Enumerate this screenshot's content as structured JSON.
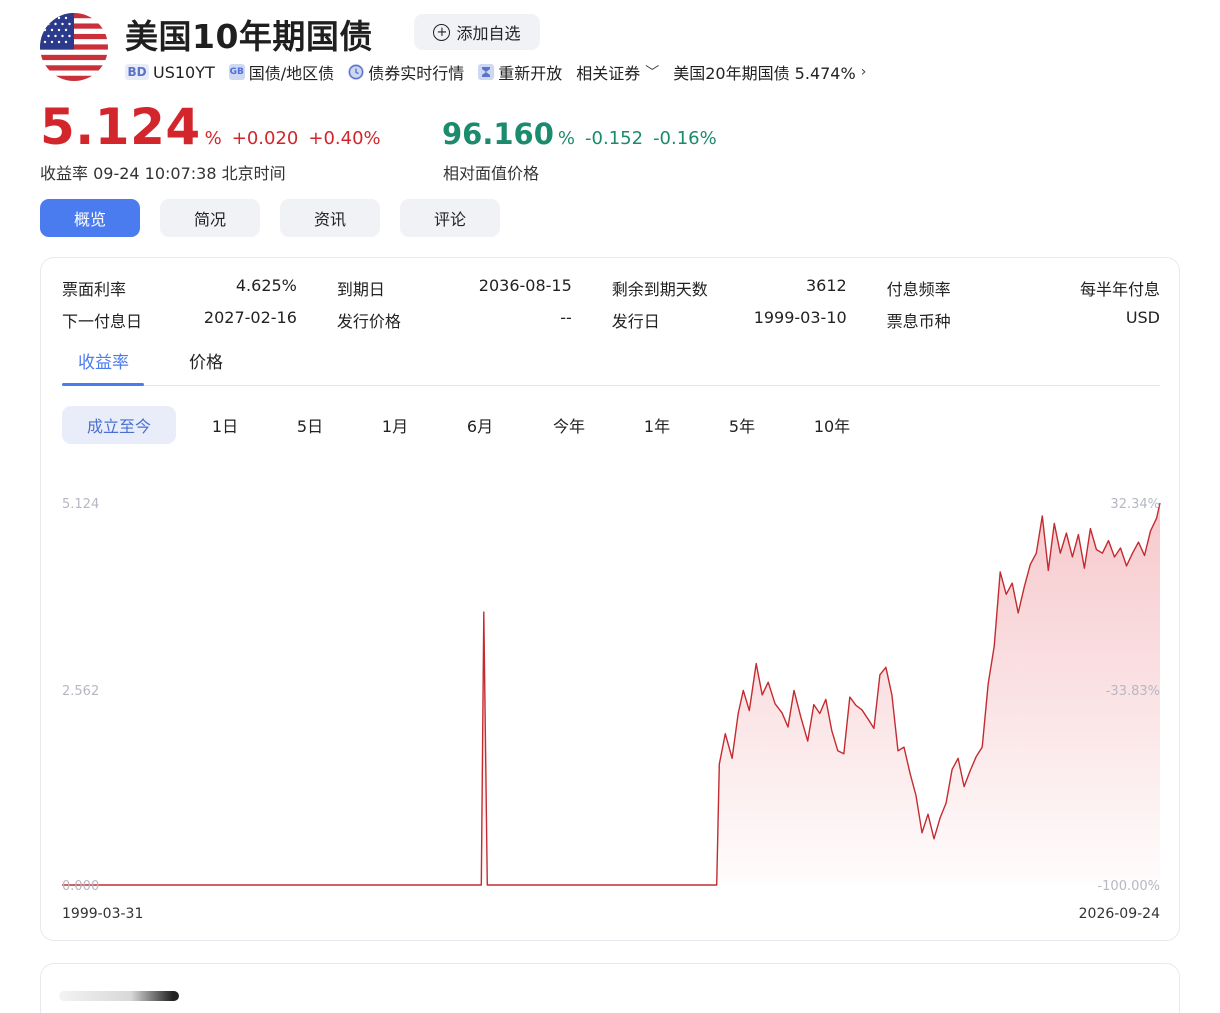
{
  "header": {
    "title": "美国10年期国债",
    "add_button": "添加自选",
    "tags": [
      {
        "icon": "bd-badge",
        "badge": "BD",
        "label": "US10YT"
      },
      {
        "icon": "gb-badge",
        "badge": "GB",
        "label": "国债/地区债"
      },
      {
        "icon": "clock-icon",
        "badge": "",
        "label": "债券实时行情"
      },
      {
        "icon": "hourglass-icon",
        "badge": "",
        "label": "重新开放"
      }
    ],
    "related": "相关证券",
    "related_link": "美国20年期国债 5.474%"
  },
  "quote": {
    "yield": "5.124",
    "yield_unit": "%",
    "yield_change": "+0.020",
    "yield_change_pct": "+0.40%",
    "yield_caption": "收益率 09-24 10:07:38 北京时间",
    "price": "96.160",
    "price_unit": "%",
    "price_change": "-0.152",
    "price_change_pct": "-0.16%",
    "price_caption": "相对面值价格",
    "up_color": "#d3262c",
    "down_color": "#1c8a6d"
  },
  "nav": [
    "概览",
    "简况",
    "资讯",
    "评论"
  ],
  "info": [
    [
      [
        "票面利率",
        "4.625%"
      ],
      [
        "到期日",
        "2036-08-15"
      ],
      [
        "剩余到期天数",
        "3612"
      ],
      [
        "付息频率",
        "每半年付息"
      ]
    ],
    [
      [
        "下一付息日",
        "2027-02-16"
      ],
      [
        "发行价格",
        "--"
      ],
      [
        "发行日",
        "1999-03-10"
      ],
      [
        "票息币种",
        "USD"
      ]
    ]
  ],
  "subtabs": [
    "收益率",
    "价格"
  ],
  "ranges": [
    "成立至今",
    "1日",
    "5日",
    "1月",
    "6月",
    "今年",
    "1年",
    "5年",
    "10年"
  ],
  "chart_data": {
    "type": "area",
    "title": "",
    "x_start": "1999-03-31",
    "x_end": "2026-09-24",
    "y_ticks_left": [
      "5.124",
      "2.562",
      "0.000"
    ],
    "y_ticks_right": [
      "32.34%",
      "-33.83%",
      "-100.00%"
    ],
    "ylim": [
      0,
      5.124
    ],
    "line_color": "#c42b30",
    "points": [
      [
        0.0,
        0
      ],
      [
        0.14,
        0
      ],
      [
        0.3,
        0
      ],
      [
        0.488,
        0
      ],
      [
        0.491,
        3.66
      ],
      [
        0.495,
        0
      ],
      [
        0.6,
        0
      ],
      [
        0.7,
        0
      ],
      [
        0.762,
        0
      ],
      [
        0.765,
        1.62
      ],
      [
        0.772,
        2.03
      ],
      [
        0.78,
        1.7
      ],
      [
        0.787,
        2.3
      ],
      [
        0.793,
        2.61
      ],
      [
        0.8,
        2.34
      ],
      [
        0.808,
        2.97
      ],
      [
        0.815,
        2.55
      ],
      [
        0.822,
        2.72
      ],
      [
        0.83,
        2.43
      ],
      [
        0.838,
        2.31
      ],
      [
        0.845,
        2.12
      ],
      [
        0.852,
        2.61
      ],
      [
        0.86,
        2.25
      ],
      [
        0.868,
        1.93
      ],
      [
        0.875,
        2.42
      ],
      [
        0.882,
        2.3
      ],
      [
        0.889,
        2.49
      ],
      [
        0.896,
        2.07
      ],
      [
        0.903,
        1.8
      ],
      [
        0.91,
        1.76
      ],
      [
        0.917,
        2.52
      ],
      [
        0.924,
        2.41
      ],
      [
        0.931,
        2.35
      ],
      [
        0.938,
        2.23
      ],
      [
        0.945,
        2.1
      ],
      [
        0.952,
        2.82
      ],
      [
        0.959,
        2.92
      ],
      [
        0.966,
        2.55
      ],
      [
        0.973,
        1.8
      ],
      [
        0.98,
        1.85
      ],
      [
        0.987,
        1.5
      ],
      [
        0.994,
        1.2
      ],
      [
        1.001,
        0.7
      ],
      [
        1.008,
        0.95
      ],
      [
        1.015,
        0.62
      ],
      [
        1.022,
        0.9
      ],
      [
        1.029,
        1.1
      ],
      [
        1.036,
        1.55
      ],
      [
        1.043,
        1.7
      ],
      [
        1.05,
        1.32
      ],
      [
        1.057,
        1.53
      ],
      [
        1.064,
        1.72
      ],
      [
        1.071,
        1.85
      ],
      [
        1.078,
        2.7
      ],
      [
        1.085,
        3.2
      ],
      [
        1.092,
        4.2
      ],
      [
        1.099,
        3.9
      ],
      [
        1.106,
        4.05
      ],
      [
        1.113,
        3.65
      ],
      [
        1.12,
        4.0
      ],
      [
        1.127,
        4.3
      ],
      [
        1.134,
        4.45
      ],
      [
        1.141,
        4.95
      ],
      [
        1.148,
        4.22
      ],
      [
        1.155,
        4.85
      ],
      [
        1.162,
        4.45
      ],
      [
        1.169,
        4.72
      ],
      [
        1.176,
        4.4
      ],
      [
        1.183,
        4.7
      ],
      [
        1.19,
        4.25
      ],
      [
        1.197,
        4.78
      ],
      [
        1.204,
        4.5
      ],
      [
        1.211,
        4.45
      ],
      [
        1.218,
        4.62
      ],
      [
        1.225,
        4.4
      ],
      [
        1.232,
        4.52
      ],
      [
        1.239,
        4.28
      ],
      [
        1.246,
        4.45
      ],
      [
        1.253,
        4.6
      ],
      [
        1.26,
        4.42
      ],
      [
        1.267,
        4.75
      ],
      [
        1.274,
        4.92
      ],
      [
        1.278,
        5.124
      ]
    ]
  },
  "footer_card": ""
}
